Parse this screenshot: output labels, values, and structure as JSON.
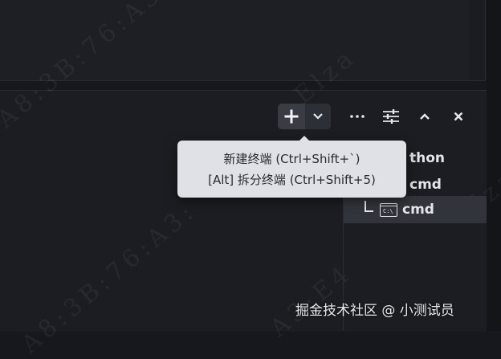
{
  "toolbar": {
    "new_terminal_icon": "plus-icon",
    "dropdown_icon": "chevron-down-icon",
    "more_icon": "ellipsis-icon",
    "settings_icon": "sliders-icon",
    "maximize_icon": "chevron-up-icon",
    "close_icon": "close-icon"
  },
  "tooltip": {
    "line1": "新建终端 (Ctrl+Shift+`)",
    "line2": "[Alt] 拆分终端 (Ctrl+Shift+5)"
  },
  "terminals": [
    {
      "label": "thon",
      "icon": "",
      "active": false
    },
    {
      "label": "cmd",
      "icon": "",
      "active": false
    },
    {
      "label": "cmd",
      "icon": "cmd-icon",
      "active": true
    }
  ],
  "cmd_icon_text": "C:\\",
  "watermarks": {
    "diagonal": [
      "A8:3B:76:A3",
      "Elza",
      "A8:3B:76:A3:",
      "A3:E4",
      "Elza"
    ],
    "site": "掘金技术社区 @ 小测试员"
  },
  "colors": {
    "background": "#17181d",
    "panel": "#1c1d22",
    "tooltip_bg": "#dfe1e6",
    "active_item": "#32343b",
    "split_button": "#3a3c44"
  }
}
